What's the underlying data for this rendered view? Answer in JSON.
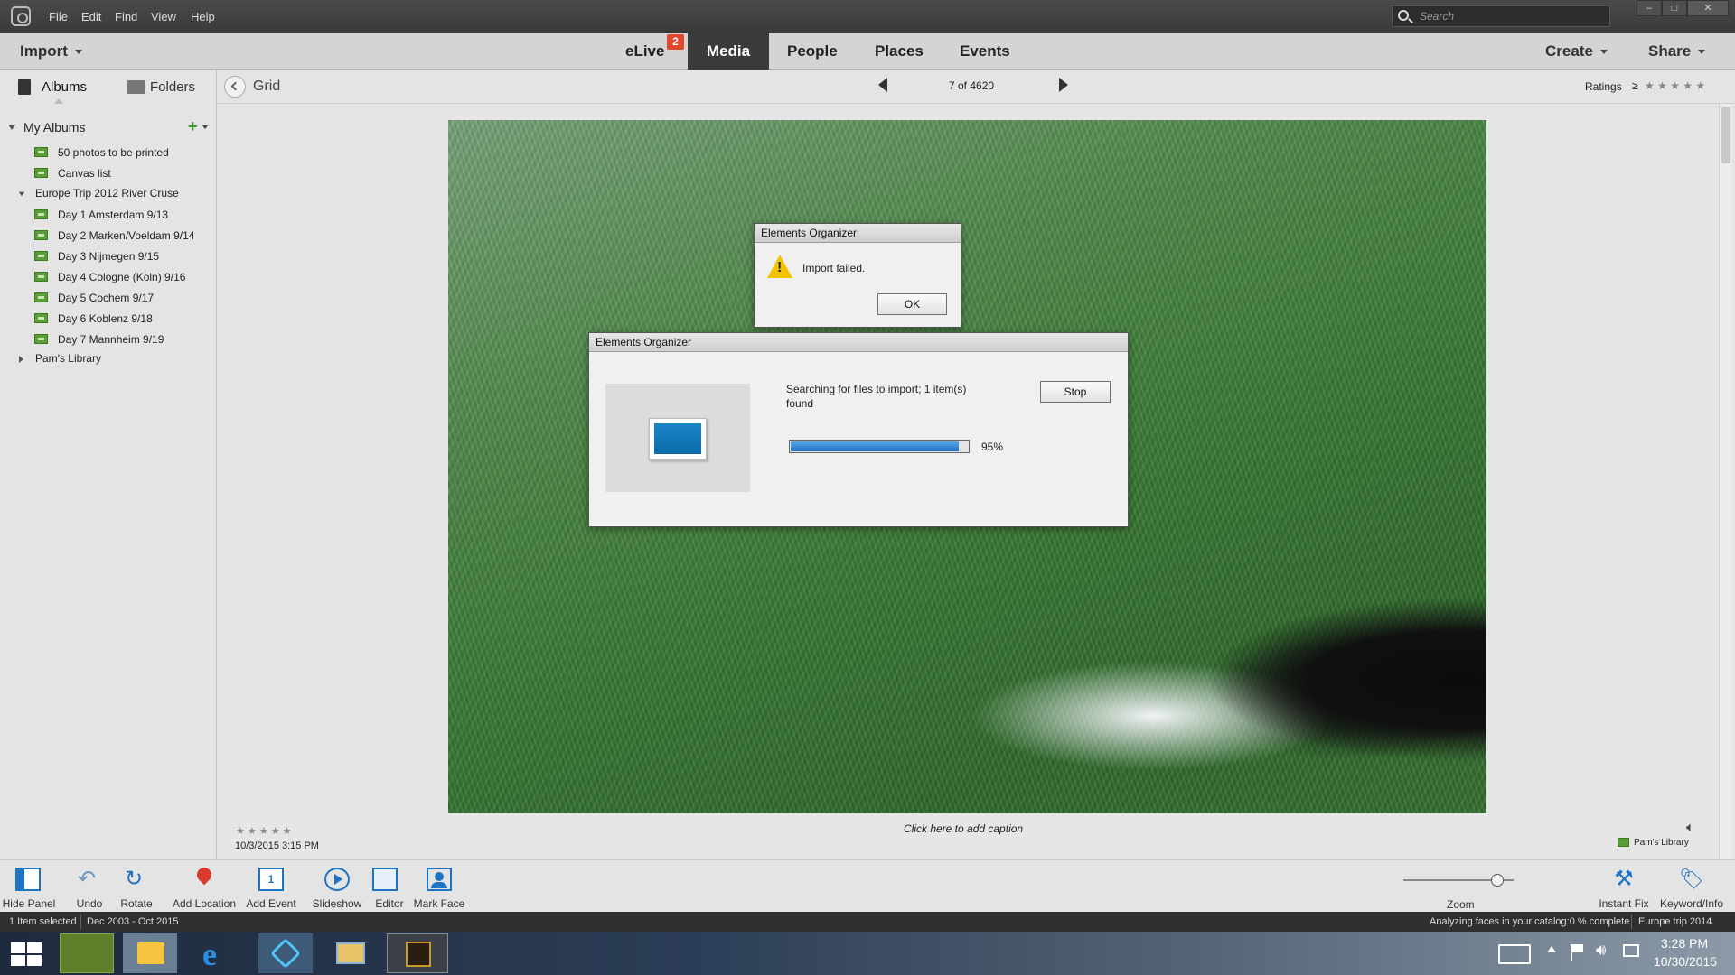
{
  "menu": {
    "items": [
      "File",
      "Edit",
      "Find",
      "View",
      "Help"
    ]
  },
  "search": {
    "placeholder": "Search"
  },
  "window_controls": {
    "minimize": "–",
    "maximize": "□",
    "close": "✕"
  },
  "toolbar": {
    "import_label": "Import",
    "tabs": [
      "eLive",
      "Media",
      "People",
      "Places",
      "Events"
    ],
    "active_tab": "Media",
    "elive_badge": "2",
    "create_label": "Create",
    "share_label": "Share"
  },
  "subbar": {
    "albums_tab": "Albums",
    "folders_tab": "Folders",
    "grid_label": "Grid",
    "counter": "7 of 4620",
    "ratings_label": "Ratings",
    "ratings_op": "≥",
    "stars": "★ ★ ★ ★ ★"
  },
  "sidebar": {
    "section_title": "My Albums",
    "albums": [
      {
        "label": "50 photos to be printed"
      },
      {
        "label": "Canvas list"
      }
    ],
    "group": {
      "label": "Europe Trip 2012 River Cruse",
      "items": [
        {
          "label": "Day 1 Amsterdam 9/13"
        },
        {
          "label": "Day 2 Marken/Voeldam 9/14"
        },
        {
          "label": "Day 3 Nijmegen 9/15"
        },
        {
          "label": "Day 4 Cologne (Koln) 9/16"
        },
        {
          "label": "Day 5 Cochem  9/17"
        },
        {
          "label": "Day 6 Koblenz 9/18"
        },
        {
          "label": "Day 7 Mannheim 9/19"
        }
      ]
    },
    "collapsed_group": {
      "label": "Pam's Library"
    }
  },
  "alert_dialog": {
    "title": "Elements Organizer",
    "message": "Import failed.",
    "ok_label": "OK"
  },
  "progress_dialog": {
    "title": "Elements Organizer",
    "message": "Searching for files to import; 1 item(s) found",
    "stop_label": "Stop",
    "percent_label": "95%",
    "progress": 0.95
  },
  "photo_info": {
    "stars": "★ ★ ★ ★ ★",
    "datetime": "10/3/2015 3:15 PM",
    "caption_placeholder": "Click here to add caption",
    "library_label": "Pam's Library"
  },
  "bottombar": {
    "buttons": [
      "Hide Panel",
      "Undo",
      "Rotate",
      "Add Location",
      "Add Event",
      "Slideshow",
      "Editor",
      "Mark Face"
    ],
    "zoom_label": "Zoom",
    "zoom_level": 0.85,
    "right_buttons": [
      "Instant Fix",
      "Keyword/Info"
    ]
  },
  "statusbar": {
    "selected": "1 Item selected",
    "date_range": "Dec 2003 - Oct 2015",
    "analyzing": "Analyzing faces in your catalog:0 % complete",
    "catalog": "Europe trip 2014"
  },
  "taskbar": {
    "time": "3:28 PM",
    "date": "10/30/2015"
  },
  "colors": {
    "accent": "#3b3b3b",
    "badge": "#e0472b",
    "progress": "#1f6fc2",
    "album_green": "#5a9e3a"
  }
}
